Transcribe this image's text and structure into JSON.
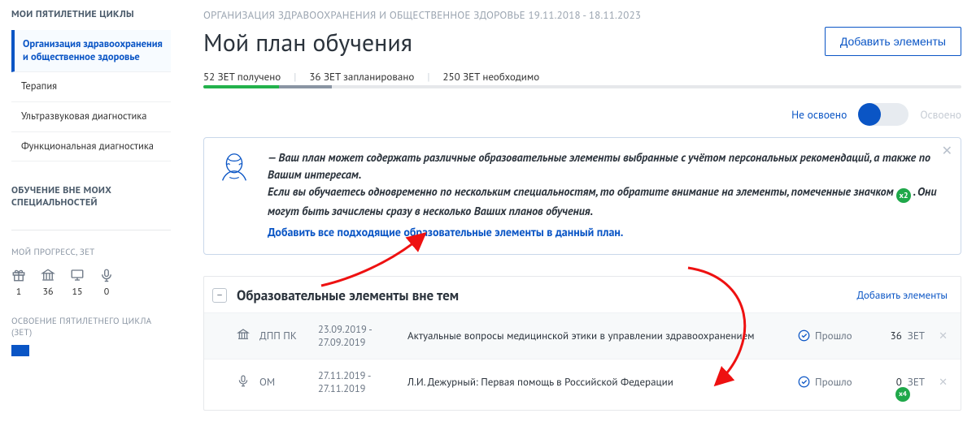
{
  "sidebar": {
    "title": "МОИ ПЯТИЛЕТНИЕ ЦИКЛЫ",
    "items": [
      {
        "label": "Организация здравоохранения и общественное здоровье",
        "active": true
      },
      {
        "label": "Терапия"
      },
      {
        "label": "Ультразвуковая диагностика"
      },
      {
        "label": "Функциональная диагностика"
      }
    ],
    "outside_title": "ОБУЧЕНИЕ ВНЕ МОИХ СПЕЦИАЛЬНОСТЕЙ",
    "progress_title": "МОЙ ПРОГРЕСС, ЗЕТ",
    "progress_items": [
      {
        "icon": "gift",
        "value": "1"
      },
      {
        "icon": "bank",
        "value": "36"
      },
      {
        "icon": "monitor",
        "value": "15"
      },
      {
        "icon": "mic",
        "value": "0"
      }
    ],
    "cycle_title": "ОСВОЕНИЕ ПЯТИЛЕТНЕГО ЦИКЛА (ЗЕТ)"
  },
  "header": {
    "breadcrumb": "ОРГАНИЗАЦИЯ ЗДРАВООХРАНЕНИЯ И ОБЩЕСТВЕННОЕ ЗДОРОВЬЕ 19.11.2018 - 18.11.2023",
    "title": "Мой план обучения",
    "add_button": "Добавить элементы",
    "stats": {
      "done": "52 ЗЕТ получено",
      "planned": "36 ЗЕТ запланировано",
      "required": "250 ЗЕТ необходимо"
    },
    "bar": {
      "done_pct": 10,
      "plan_pct": 7
    }
  },
  "toggle": {
    "left": "Не освоено",
    "right": "Освоено"
  },
  "info": {
    "text1": "— Ваш план может содержать различные образовательные элементы выбранные с учётом персональных рекомендаций, а также по Вашим интересам.",
    "text2a": "Если вы обучаетесь одновременно по нескольким специальностям, то обратите внимание на элементы, помеченные значком ",
    "badge": "x2",
    "text2b": ". Они могут быть зачислены сразу в несколько Ваших планов обучения.",
    "link": "Добавить все подходящие образовательные элементы в данный план."
  },
  "section": {
    "title": "Образовательные элементы вне тем",
    "add": "Добавить элементы",
    "rows": [
      {
        "icon": "bank",
        "type": "ДПП ПК",
        "date": "23.09.2019 - 27.09.2019",
        "title": "Актуальные вопросы медицинской этики в управлении здравоохранением",
        "status": "Прошло",
        "zet": "36",
        "unit": "ЗЕТ"
      },
      {
        "icon": "mic",
        "type": "ОМ",
        "date": "27.11.2019 - 27.11.2019",
        "title": "Л.И. Дежурный: Первая помощь в Российской Федерации",
        "status": "Прошло",
        "zet": "0",
        "unit": "ЗЕТ",
        "x4": "x4"
      }
    ]
  }
}
